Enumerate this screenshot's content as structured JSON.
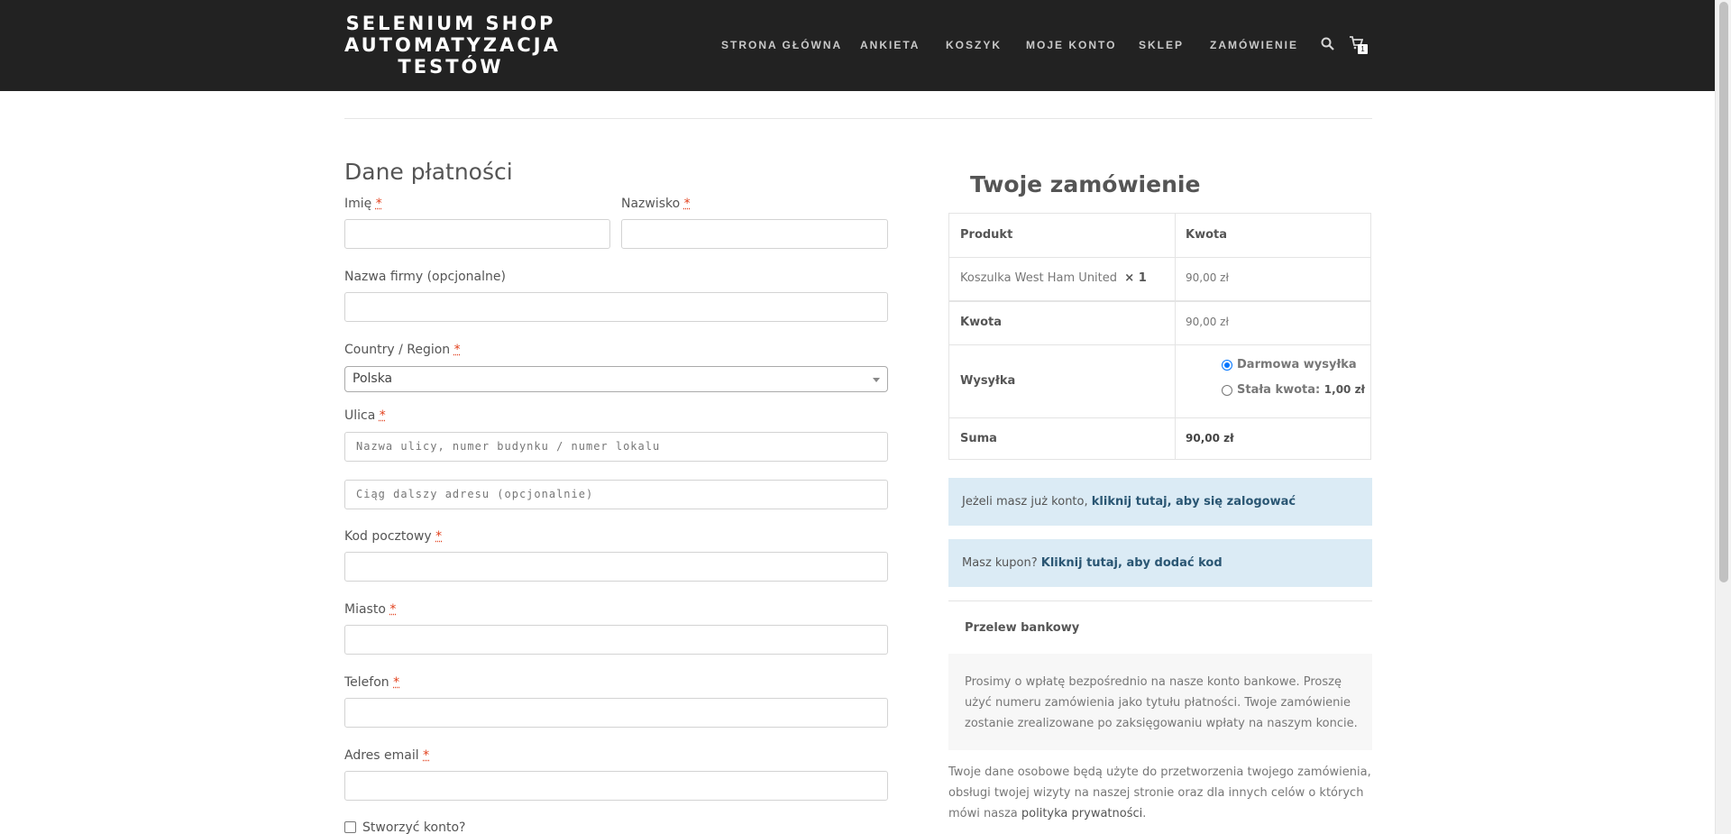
{
  "header": {
    "brand": [
      "SELENIUM SHOP",
      "AUTOMATYZACJA",
      "TESTÓW"
    ],
    "nav": [
      "STRONA GŁÓWNA",
      "ANKIETA",
      "KOSZYK",
      "MOJE KONTO",
      "SKLEP",
      "ZAMÓWIENIE"
    ],
    "cart_count": "1"
  },
  "billing": {
    "title": "Dane płatności",
    "first_name_label": "Imię",
    "last_name_label": "Nazwisko",
    "company_label": "Nazwa firmy (opcjonalne)",
    "country_label": "Country / Region",
    "country_value": "Polska",
    "street_label": "Ulica",
    "street_placeholder": "Nazwa ulicy, numer budynku / numer lokalu",
    "street2_placeholder": "Ciąg dalszy adresu (opcjonalnie)",
    "postcode_label": "Kod pocztowy",
    "city_label": "Miasto",
    "phone_label": "Telefon",
    "email_label": "Adres email",
    "create_account_label": "Stworzyć konto?",
    "required_mark": "*"
  },
  "order": {
    "title": "Twoje zamówienie",
    "col_product": "Produkt",
    "col_amount": "Kwota",
    "item_name": "Koszulka West Ham United",
    "item_qty": "× 1",
    "item_price": "90,00 zł",
    "subtotal_label": "Kwota",
    "subtotal_value": "90,00 zł",
    "shipping_label": "Wysyłka",
    "shipping_free": "Darmowa wysyłka",
    "shipping_flat": "Stała kwota:",
    "shipping_flat_price": "1,00 zł",
    "total_label": "Suma",
    "total_value": "90,00 zł"
  },
  "notices": {
    "login_text": "Jeżeli masz już konto,",
    "login_link": "kliknij tutaj, aby się zalogować",
    "coupon_text": "Masz kupon?",
    "coupon_link": "Kliknij tutaj, aby dodać kod"
  },
  "payment": {
    "method": "Przelew bankowy",
    "description": "Prosimy o wpłatę bezpośrednio na nasze konto bankowe. Proszę użyć numeru zamówienia jako tytułu płatności. Twoje zamówienie zostanie zrealizowane po zaksięgowaniu wpłaty na naszym koncie.",
    "privacy_text": "Twoje dane osobowe będą użyte do przetworzenia twojego zamówienia, obsługi twojej wizyty na naszej stronie oraz dla innych celów o których mówi nasza",
    "privacy_link": "polityka prywatności",
    "privacy_end": "."
  }
}
